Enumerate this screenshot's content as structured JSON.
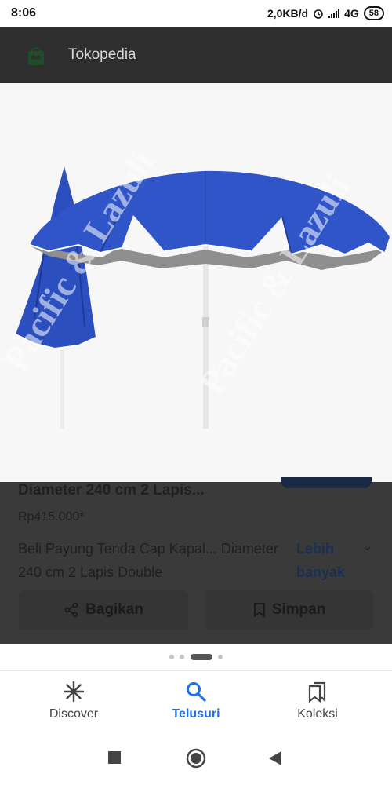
{
  "status_bar": {
    "time": "8:06",
    "data_rate": "2,0KB/d",
    "network": "4G",
    "battery": "58"
  },
  "app_bar": {
    "title": "Tokopedia",
    "logo_icon": "tokopedia-bag-icon"
  },
  "image": {
    "watermark": "Pacific & Lazuli",
    "colors": {
      "canopy": "#2f55c8",
      "lining": "#8d8d8d",
      "pole": "#e8e8e8"
    }
  },
  "product": {
    "title": "Diameter 240 cm 2 Lapis...",
    "price": "Rp415.000*",
    "description": "Beli Payung Tenda Cap Kapal... Diameter 240 cm 2 Lapis Double",
    "more_label": "Lebih banyak"
  },
  "actions": {
    "share_label": "Bagikan",
    "save_label": "Simpan"
  },
  "pager": {
    "count": 4,
    "active_index": 2
  },
  "bottom_nav": {
    "items": [
      {
        "label": "Discover",
        "icon": "asterisk-icon"
      },
      {
        "label": "Telusuri",
        "icon": "search-icon",
        "active": true
      },
      {
        "label": "Koleksi",
        "icon": "bookmarks-icon"
      }
    ],
    "accent": "#1a73e8"
  },
  "system_nav": {
    "buttons": [
      "recents-square-icon",
      "home-circle-icon",
      "back-triangle-icon"
    ]
  }
}
